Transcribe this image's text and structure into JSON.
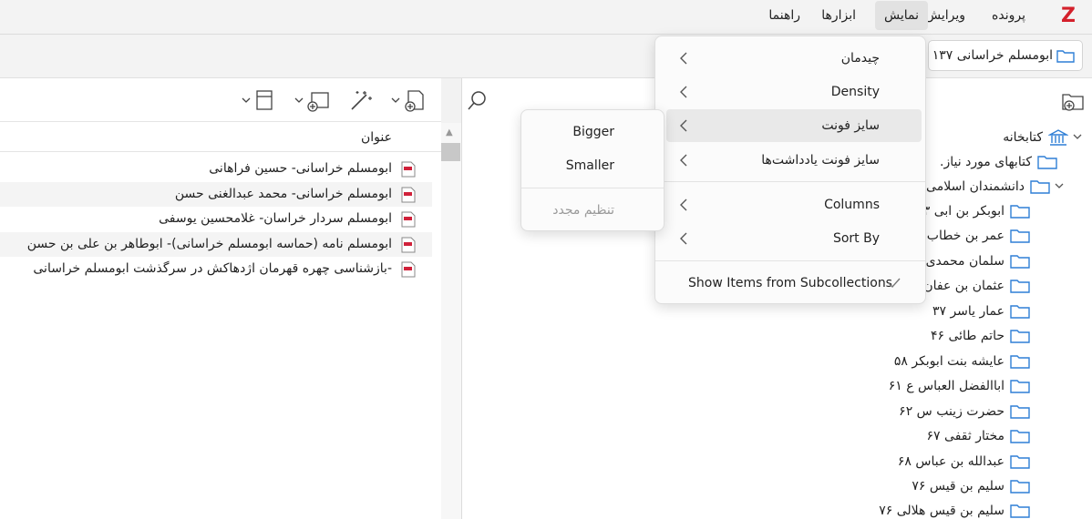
{
  "menubar": {
    "logo": "Z",
    "items": [
      "پرونده",
      "ویرایش",
      "نمایش",
      "ابزارها",
      "راهنما"
    ]
  },
  "collection_header": {
    "label": "۱۳۷ ابومسلم خراسانی"
  },
  "items": {
    "column_title": "عنوان",
    "rows": [
      "ابومسلم خراسانی- حسین فراهانی",
      "ابومسلم خراسانی- محمد عبدالغنی حسن",
      "ابومسلم سردار خراسان- غلامحسین یوسفی",
      "ابومسلم نامه (حماسه ابومسلم خراسانی)- ابوطاهر بن علی بن حسن",
      "بازشناسی چهره قهرمان اژدهاکش در سرگذشت ابومسلم خراسانی-"
    ]
  },
  "tree": {
    "library": "کتابخانه",
    "items": [
      ".کتابهای مورد نیاز",
      "۱. دانشمندان اسلامی",
      "۱۳ ابوبکر بن ابی",
      "۲۳ عمر بن خطاب",
      "۳۲ سلمان محمدی",
      "۳۵ عثمان بن عفان",
      "۳۷ عمار یاسر",
      "۴۶ حاتم طائی",
      "۵۸ عایشه بنت ابوبکر",
      "۶۱ اباالفضل العباس ع",
      "۶۲ حضرت زینب س",
      "۶۷ مختار ثقفی",
      "۶۸ عبدالله بن عباس",
      "۷۶ سلیم بن قیس",
      "۷۶ سلیم بن قیس هلالی"
    ]
  },
  "view_menu": {
    "items": [
      {
        "label": "چیدمان"
      },
      {
        "label": "Density"
      },
      {
        "label": "سایز فونت"
      },
      {
        "label": "سایز فونت یادداشت‌ها"
      },
      {
        "label": "Columns"
      },
      {
        "label": "Sort By"
      }
    ],
    "toggle": {
      "label": "Show Items from Subcollections",
      "checked": true
    }
  },
  "font_submenu": {
    "bigger": "Bigger",
    "smaller": "Smaller",
    "reset": "تنظیم مجدد"
  },
  "colors": {
    "accent": "#2f7fd6",
    "brand": "#d4202b",
    "pdf": "#d0213a"
  }
}
